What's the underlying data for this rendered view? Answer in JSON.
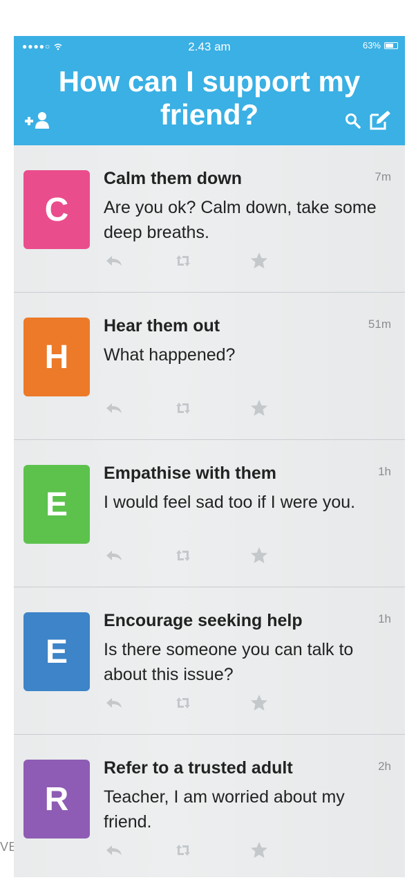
{
  "page": {
    "cut_text": "VE"
  },
  "status_bar": {
    "carrier": "●●●●○",
    "time": "2.43 am",
    "battery": "63%"
  },
  "header": {
    "title": "How can I support my friend?",
    "icons": [
      "add-user-icon",
      "search-icon",
      "compose-icon"
    ]
  },
  "feed": {
    "items": [
      {
        "letter": "C",
        "color": "#ea4d8c",
        "title": "Calm them down",
        "time": "7m",
        "body": "Are you ok? Calm down, take some deep breaths."
      },
      {
        "letter": "H",
        "color": "#ec7a29",
        "title": "Hear them out",
        "time": "51m",
        "body": "What happened?"
      },
      {
        "letter": "E",
        "color": "#5cc24c",
        "title": "Empathise with them",
        "time": "1h",
        "body": "I would feel sad too if I were you."
      },
      {
        "letter": "E",
        "color": "#3d84c8",
        "title": "Encourage seeking help",
        "time": "1h",
        "body": "Is there someone you can talk to about this issue?"
      },
      {
        "letter": "R",
        "color": "#8e5cb4",
        "title": "Refer to a trusted adult",
        "time": "2h",
        "body": "Teacher, I am worried about my friend."
      }
    ],
    "action_icons": [
      "reply-icon",
      "retweet-icon",
      "star-icon"
    ]
  }
}
